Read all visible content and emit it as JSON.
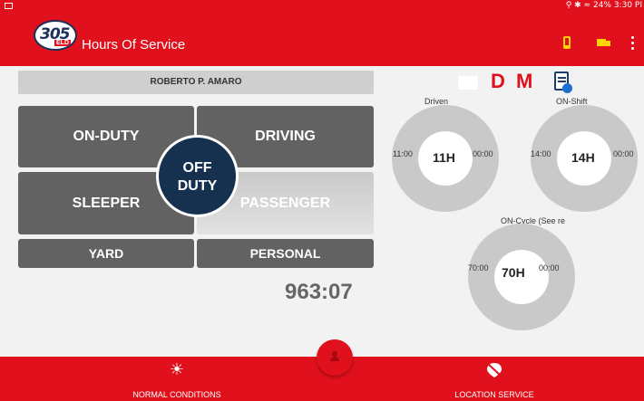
{
  "status_bar": {
    "right_text": "24% 3:30 PI"
  },
  "app": {
    "logo_number": "305",
    "logo_badge": "ELD",
    "title": "Hours Of Service"
  },
  "driver": {
    "name": "ROBERTO P. AMARO"
  },
  "duty_status": {
    "on_duty": "ON-DUTY",
    "driving": "DRIVING",
    "off_duty_line1": "OFF",
    "off_duty_line2": "DUTY",
    "sleeper": "SLEEPER",
    "passenger": "PASSENGER",
    "yard": "YARD",
    "personal": "PERSONAL"
  },
  "timer": "963:07",
  "indicators": {
    "d": "D",
    "m": "M"
  },
  "gauges": {
    "driven": {
      "label": "Driven",
      "left": "11:00",
      "center": "11H",
      "right": "00:00"
    },
    "on_shift": {
      "label": "ON-Shift",
      "left": "14:00",
      "center": "14H",
      "right": "00:00"
    },
    "on_cycle": {
      "label": "ON-Cycle (See re",
      "left": "70:00",
      "center": "70H",
      "right": "00:00"
    }
  },
  "bottom_bar": {
    "left_label": "NORMAL CONDITIONS",
    "right_label": "LOCATION SERVICE"
  },
  "icons": [
    "image-icon",
    "phone-icon",
    "truck-icon",
    "more-vert-icon",
    "mail-icon",
    "clipboard-check-icon",
    "person-icon",
    "sun-icon",
    "location-off-icon"
  ],
  "colors": {
    "primary": "#e0101c",
    "duty_button": "#626262",
    "off_duty": "#16314f",
    "gauge": "#c9c9c9"
  }
}
